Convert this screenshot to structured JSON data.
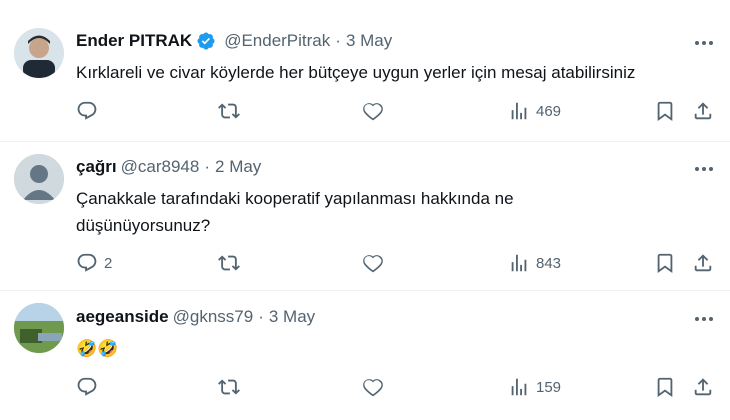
{
  "tweets": [
    {
      "name": "Ender PITRAK",
      "verified": true,
      "handle": "@EnderPitrak",
      "separator": "·",
      "date": "3 May",
      "text": "Kırklareli ve civar köylerde her bütçeye uygun yerler için mesaj atabilirsiniz",
      "replies": "",
      "retweets": "",
      "likes": "",
      "views": "469"
    },
    {
      "name": "çağrı",
      "verified": false,
      "handle": "@car8948",
      "separator": "·",
      "date": "2 May",
      "text": "Çanakkale tarafındaki kooperatif yapılanması hakkında ne düşünüyorsunuz?",
      "replies": "2",
      "retweets": "",
      "likes": "",
      "views": "843"
    },
    {
      "name": "aegeanside",
      "verified": false,
      "handle": "@gknss79",
      "separator": "·",
      "date": "3 May",
      "text": "🤣🤣",
      "replies": "",
      "retweets": "",
      "likes": "",
      "views": "159"
    }
  ],
  "icons": {
    "reply": "reply-icon",
    "retweet": "retweet-icon",
    "like": "heart-icon",
    "views": "views-chart-icon",
    "bookmark": "bookmark-icon",
    "share": "share-icon",
    "more": "more-dots-icon",
    "verified": "verified-badge-icon"
  },
  "colors": {
    "verified": "#1d9bf0",
    "secondary_text": "#536471",
    "divider": "#eff3f4"
  }
}
